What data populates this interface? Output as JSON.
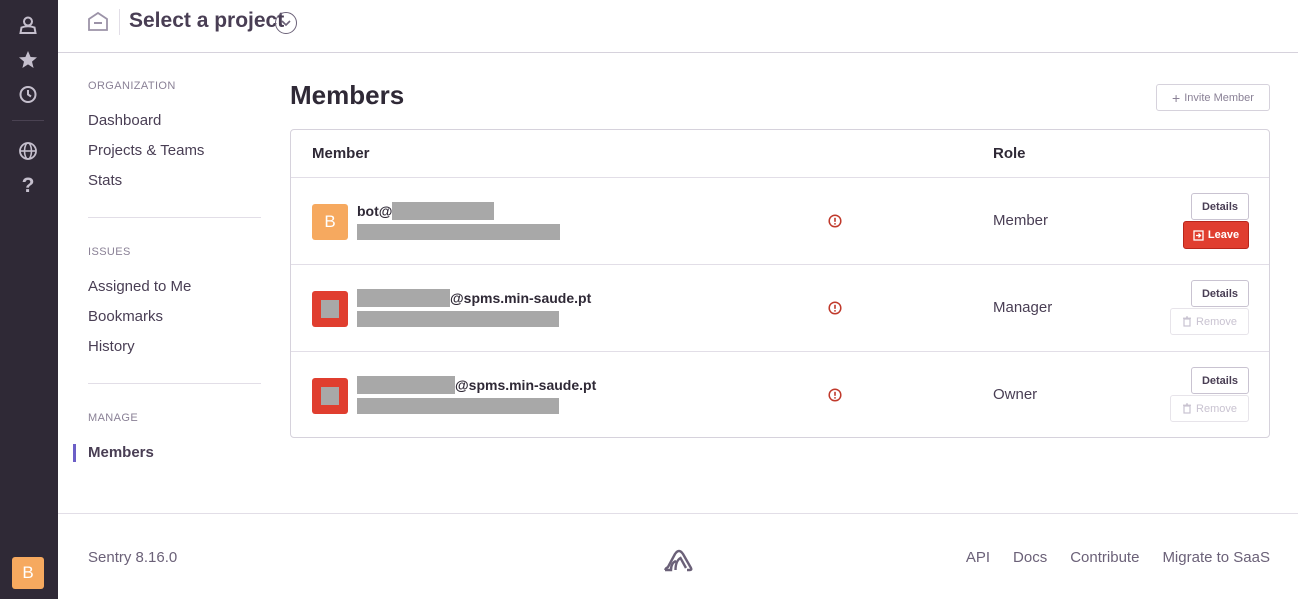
{
  "rail": {
    "icons": [
      "user-icon",
      "star-icon",
      "clock-icon",
      "globe-icon",
      "help-icon"
    ],
    "help_glyph": "?",
    "avatar_letter": "B"
  },
  "header": {
    "project_selector_label": "Select a project",
    "icons": [
      "home-icon",
      "chevron-down-icon"
    ]
  },
  "nav": {
    "organization_heading": "ORGANIZATION",
    "organization_items": [
      "Dashboard",
      "Projects & Teams",
      "Stats"
    ],
    "issues_heading": "ISSUES",
    "issues_items": [
      "Assigned to Me",
      "Bookmarks",
      "History"
    ],
    "manage_heading": "MANAGE",
    "manage_items": [
      "Members"
    ],
    "active_item": "Members"
  },
  "main": {
    "title": "Members",
    "invite_button": "Invite Member",
    "table": {
      "columns": [
        "Member",
        "Role"
      ],
      "rows": [
        {
          "avatar_letter": "B",
          "email_prefix": "bot@",
          "email_suffix": "",
          "role": "Member",
          "actions": [
            "Details",
            "Leave"
          ]
        },
        {
          "avatar_letter": "",
          "email_prefix": "",
          "email_suffix": "@spms.min-saude.pt",
          "role": "Manager",
          "actions": [
            "Details",
            "Remove"
          ]
        },
        {
          "avatar_letter": "",
          "email_prefix": "",
          "email_suffix": "@spms.min-saude.pt",
          "role": "Owner",
          "actions": [
            "Details",
            "Remove"
          ]
        }
      ]
    }
  },
  "footer": {
    "version": "Sentry 8.16.0",
    "links": [
      "API",
      "Docs",
      "Contribute",
      "Migrate to SaaS"
    ]
  },
  "colors": {
    "rail_bg": "#2f2936",
    "accent": "#6c5fc7",
    "danger": "#e03e2f",
    "avatar_orange": "#f6a95f",
    "warning_icon": "#c0392b"
  }
}
